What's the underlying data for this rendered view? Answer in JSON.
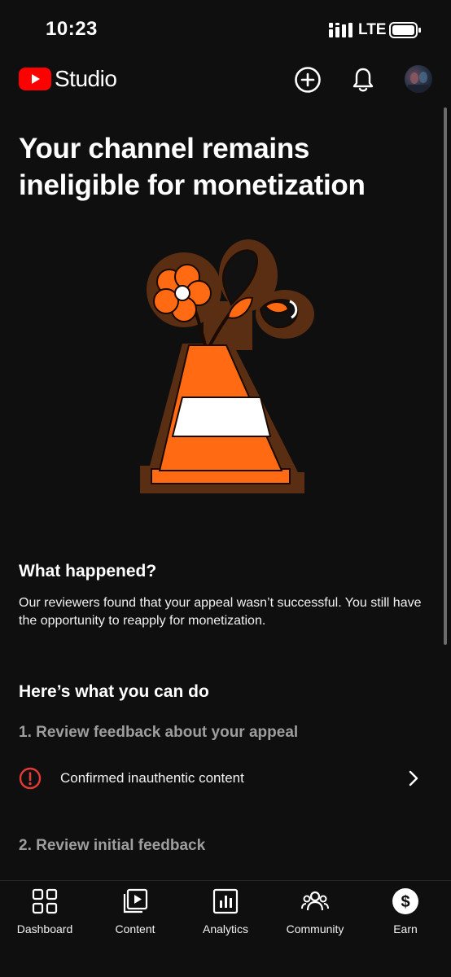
{
  "status_bar": {
    "time": "10:23",
    "network": "LTE"
  },
  "header": {
    "brand": "Studio",
    "icons": [
      "youtube-logo",
      "create-icon",
      "bell-icon",
      "avatar"
    ]
  },
  "main": {
    "title": "Your channel remains ineligible for monetization",
    "what_happened": {
      "heading": "What happened?",
      "body": "Our reviewers found that your appeal wasn’t successful. You still have the opportunity to reapply for monetization."
    },
    "what_to_do": {
      "heading": "Here’s what you can do",
      "step1": "1. Review feedback about your appeal",
      "feedback_item": "Confirmed inauthentic content",
      "step2": "2. Review initial feedback"
    }
  },
  "bottom_nav": {
    "items": [
      {
        "label": "Dashboard",
        "icon": "dashboard-icon"
      },
      {
        "label": "Content",
        "icon": "content-icon"
      },
      {
        "label": "Analytics",
        "icon": "analytics-icon"
      },
      {
        "label": "Community",
        "icon": "community-icon"
      },
      {
        "label": "Earn",
        "icon": "earn-icon"
      }
    ]
  },
  "colors": {
    "background": "#0f0f0f",
    "brand_red": "#ff0000",
    "alert_red": "#e53935",
    "cone_orange": "#ff6a13",
    "muted_text": "#9e9e9e"
  }
}
